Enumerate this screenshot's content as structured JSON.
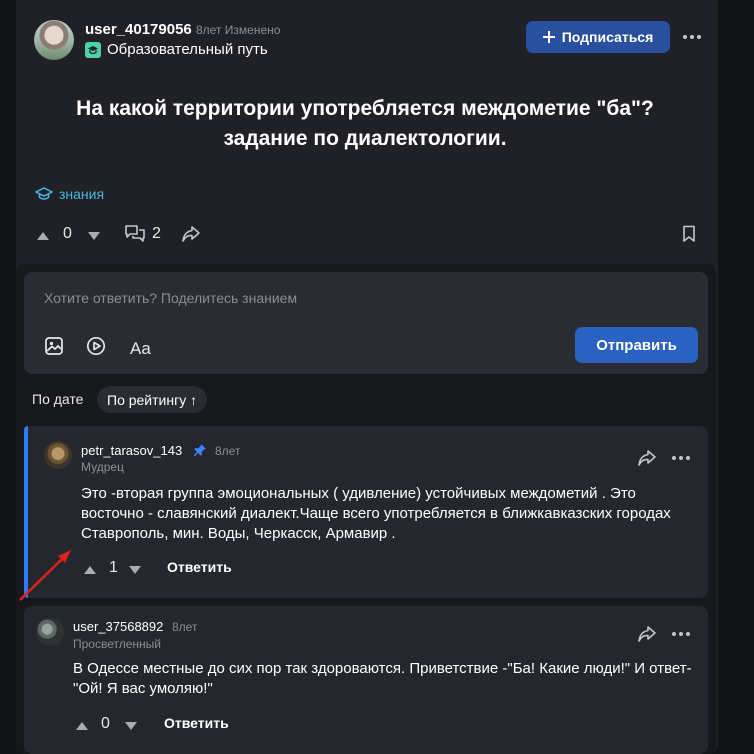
{
  "question": {
    "author": "user_40179056",
    "meta": "8лет Изменено",
    "subject": "Образовательный путь",
    "subscribe_label": "Подписаться",
    "title_line1": "На какой территории употребляется междометие \"ба\"?",
    "title_line2": "задание по диалектологии.",
    "tag": "знания",
    "votes": "0",
    "comments": "2"
  },
  "composer": {
    "placeholder": "Хотите ответить? Поделитесь знанием",
    "font_tool": "Aa",
    "send_label": "Отправить"
  },
  "sort": {
    "by_date": "По дате",
    "by_rating": "По рейтингу ↑"
  },
  "answers": [
    {
      "author": "petr_tarasov_143",
      "age": "8лет",
      "rank": "Мудрец",
      "text_line1": "Это -вторая группа эмоциональных ( удивление) устойчивых междометий . Это",
      "text_line2": "восточно - славянский диалект.Чаще всего употребляется в ближкавказских городах",
      "text_line3": "Ставрополь, мин. Воды, Черкасск, Армавир .",
      "votes": "1",
      "reply_label": "Ответить",
      "accent_color": "#2e7bff"
    },
    {
      "author": "user_37568892",
      "age": "8лет",
      "rank": "Просветленный",
      "text_line1": "В Одессе местные до сих пор так здороваются. Приветствие -\"Ба! Какие люди!\" И ответ-",
      "text_line2": "\"Ой! Я вас умоляю!\"",
      "votes": "0",
      "reply_label": "Ответить"
    }
  ],
  "icons": {
    "plus": "plus-icon",
    "more": "more-dots-icon",
    "subject": "graduation-cap-icon",
    "upvote": "arrow-up-icon",
    "downvote": "arrow-down-icon",
    "comment": "comments-icon",
    "share": "share-icon",
    "bookmark": "bookmark-icon",
    "image": "image-icon",
    "video": "play-icon",
    "pin": "pin-icon"
  },
  "colors": {
    "primary_button": "#2962c0",
    "subscribe_button": "#2a4f9f",
    "tag": "#49b6e3",
    "annotation_arrow": "#e0201b"
  }
}
